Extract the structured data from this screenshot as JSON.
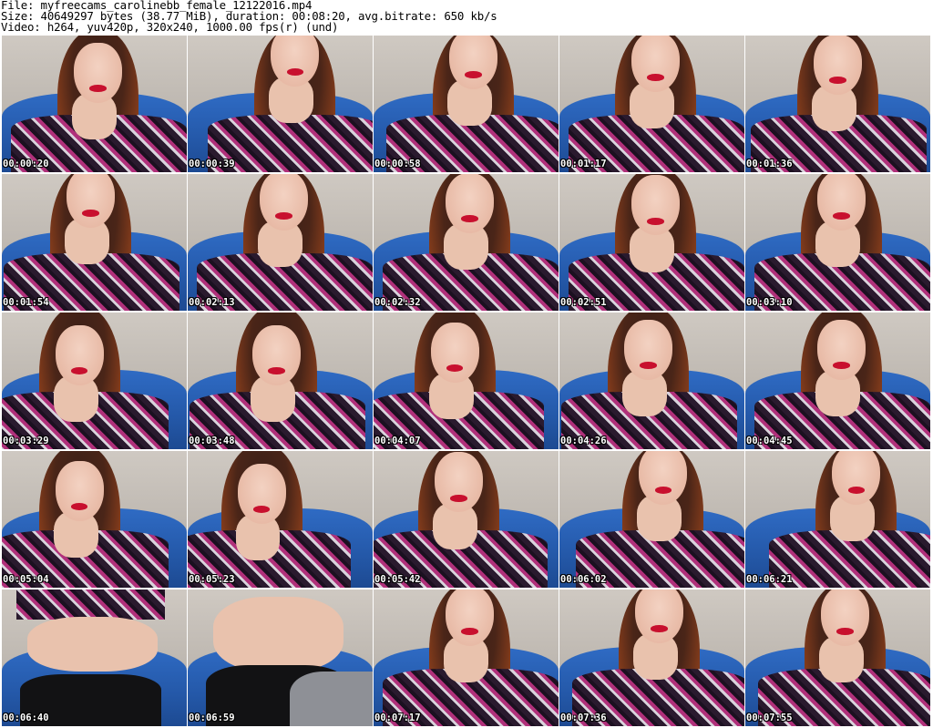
{
  "header": {
    "file_line": "File: myfreecams_carolinebb_female_12122016.mp4",
    "size_line": "Size: 40649297 bytes (38.77 MiB), duration: 00:08:20, avg.bitrate: 650 kb/s",
    "video_line": "Video: h264, yuv420p, 320x240, 1000.00 fps(r) (und)"
  },
  "thumbnails": [
    {
      "time": "00:00:20"
    },
    {
      "time": "00:00:39"
    },
    {
      "time": "00:00:58"
    },
    {
      "time": "00:01:17"
    },
    {
      "time": "00:01:36"
    },
    {
      "time": "00:01:54"
    },
    {
      "time": "00:02:13"
    },
    {
      "time": "00:02:32"
    },
    {
      "time": "00:02:51"
    },
    {
      "time": "00:03:10"
    },
    {
      "time": "00:03:29"
    },
    {
      "time": "00:03:48"
    },
    {
      "time": "00:04:07"
    },
    {
      "time": "00:04:26"
    },
    {
      "time": "00:04:45"
    },
    {
      "time": "00:05:04"
    },
    {
      "time": "00:05:23"
    },
    {
      "time": "00:05:42"
    },
    {
      "time": "00:06:02"
    },
    {
      "time": "00:06:21"
    },
    {
      "time": "00:06:40"
    },
    {
      "time": "00:06:59"
    },
    {
      "time": "00:07:17"
    },
    {
      "time": "00:07:36"
    },
    {
      "time": "00:07:55"
    }
  ]
}
